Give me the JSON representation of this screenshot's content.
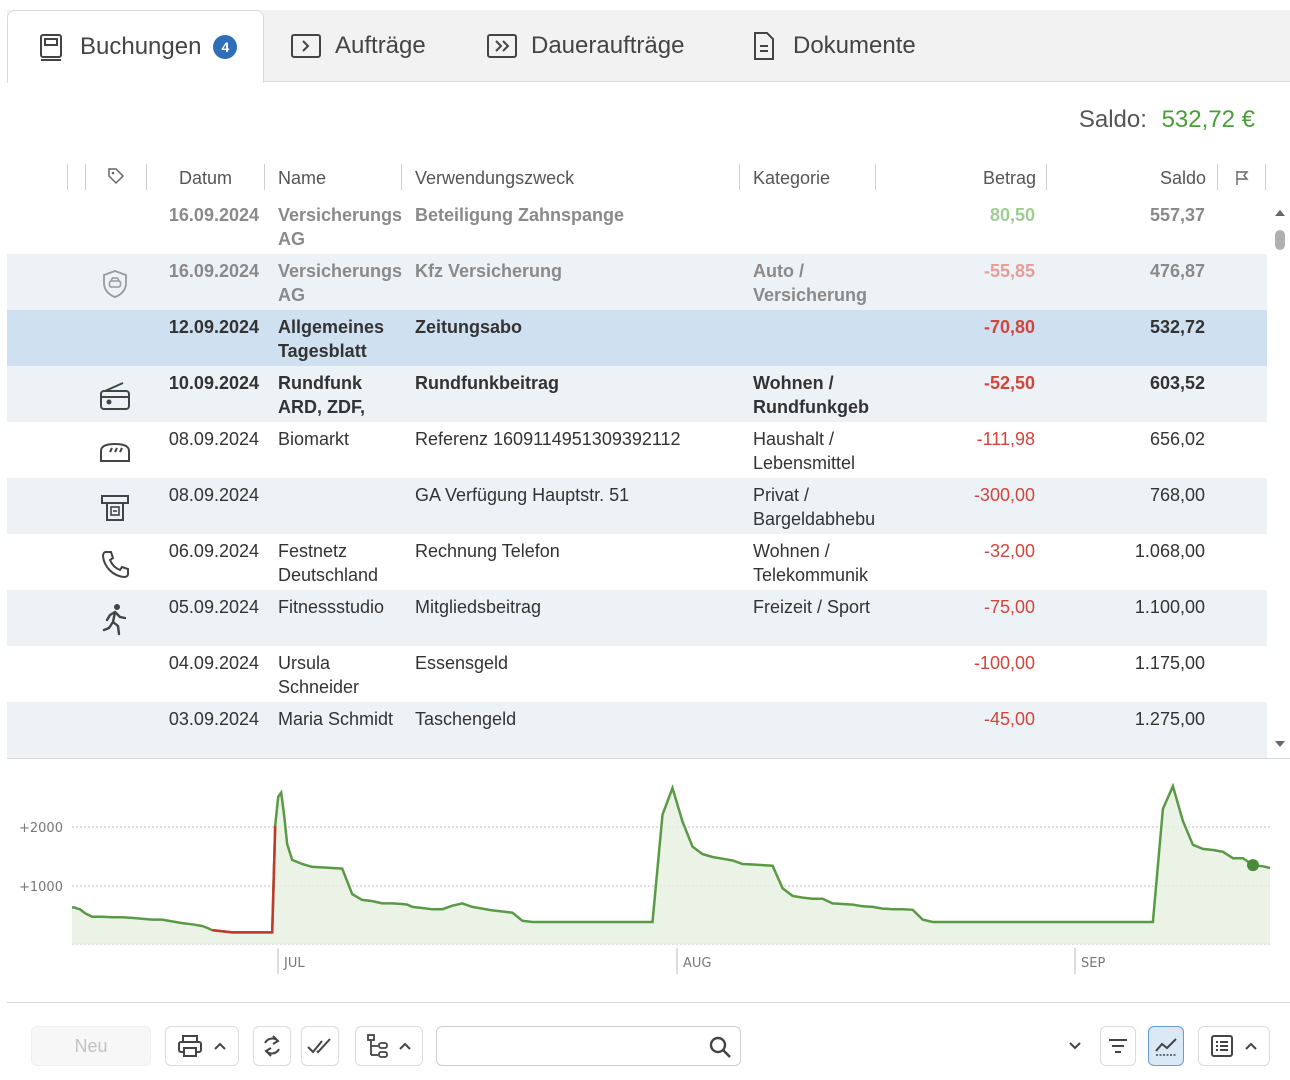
{
  "tabs": [
    {
      "label": "Buchungen",
      "badge": "4",
      "icon": "book-icon",
      "active": true
    },
    {
      "label": "Aufträge",
      "icon": "arrow-box-icon",
      "active": false
    },
    {
      "label": "Daueraufträge",
      "icon": "double-arrow-box-icon",
      "active": false
    },
    {
      "label": "Dokumente",
      "icon": "document-icon",
      "active": false
    }
  ],
  "saldo": {
    "label": "Saldo:",
    "value": "532,72 €"
  },
  "columns": {
    "date": "Datum",
    "name": "Name",
    "purpose": "Verwendungszweck",
    "category": "Kategorie",
    "amount": "Betrag",
    "balance": "Saldo"
  },
  "rows": [
    {
      "date": "16.09.2024",
      "name": "Versicherungs AG",
      "purpose": "Beteiligung Zahnspange",
      "category": "",
      "amount": "80,50",
      "balance": "557,37",
      "icon": "",
      "style": "faded",
      "sign": "pos"
    },
    {
      "date": "16.09.2024",
      "name": "Versicherungs AG",
      "purpose": "Kfz Versicherung",
      "category": "Auto / Versicherung",
      "amount": "-55,85",
      "balance": "476,87",
      "icon": "shield-car-icon",
      "style": "faded",
      "sign": "neg"
    },
    {
      "date": "12.09.2024",
      "name": "Allgemeines Tagesblatt",
      "purpose": "Zeitungsabo",
      "category": "",
      "amount": "-70,80",
      "balance": "532,72",
      "icon": "",
      "style": "bold",
      "sign": "neg"
    },
    {
      "date": "10.09.2024",
      "name": "Rundfunk ARD, ZDF,",
      "purpose": "Rundfunkbeitrag",
      "category": "Wohnen / Rundfunkgeb",
      "amount": "-52,50",
      "balance": "603,52",
      "icon": "radio-icon",
      "style": "bold",
      "sign": "neg"
    },
    {
      "date": "08.09.2024",
      "name": "Biomarkt",
      "purpose": "Referenz 1609114951309392112",
      "category": "Haushalt / Lebensmittel",
      "amount": "-111,98",
      "balance": "656,02",
      "icon": "bread-icon",
      "style": "normal",
      "sign": "neg"
    },
    {
      "date": "08.09.2024",
      "name": "",
      "purpose": "GA Verfügung Hauptstr. 51",
      "category": "Privat / Bargeldabhebu",
      "amount": "-300,00",
      "balance": "768,00",
      "icon": "atm-icon",
      "style": "normal",
      "sign": "neg"
    },
    {
      "date": "06.09.2024",
      "name": "Festnetz Deutschland",
      "purpose": "Rechnung Telefon",
      "category": "Wohnen / Telekommunik",
      "amount": "-32,00",
      "balance": "1.068,00",
      "icon": "phone-icon",
      "style": "normal",
      "sign": "neg"
    },
    {
      "date": "05.09.2024",
      "name": "Fitnessstudio",
      "purpose": "Mitgliedsbeitrag",
      "category": "Freizeit / Sport",
      "amount": "-75,00",
      "balance": "1.100,00",
      "icon": "running-icon",
      "style": "normal",
      "sign": "neg"
    },
    {
      "date": "04.09.2024",
      "name": "Ursula Schneider",
      "purpose": "Essensgeld",
      "category": "",
      "amount": "-100,00",
      "balance": "1.175,00",
      "icon": "",
      "style": "normal",
      "sign": "neg"
    },
    {
      "date": "03.09.2024",
      "name": "Maria Schmidt",
      "purpose": "Taschengeld",
      "category": "",
      "amount": "-45,00",
      "balance": "1.275,00",
      "icon": "",
      "style": "normal",
      "sign": "neg"
    }
  ],
  "chart_data": {
    "type": "area",
    "ytick_labels": [
      "+2000",
      "+1000"
    ],
    "ytick_values": [
      2000,
      1000
    ],
    "month_labels": [
      "JUL",
      "AUG",
      "SEP"
    ],
    "ylim": [
      0,
      2700
    ],
    "colors": {
      "line": "#5a9a47",
      "negative": "#c0392b",
      "fill": "#e6f1e1"
    },
    "x": [
      0,
      3,
      5,
      8,
      10,
      14,
      18,
      20,
      25,
      30,
      40,
      50,
      60,
      80,
      90,
      100,
      110,
      120,
      130,
      135,
      140,
      150,
      160,
      170,
      180,
      190,
      200,
      203,
      206,
      209,
      212,
      215,
      220,
      230,
      240,
      250,
      260,
      270,
      280,
      290,
      300,
      310,
      320,
      330,
      335,
      340,
      350,
      360,
      370,
      380,
      390,
      400,
      410,
      420,
      430,
      440,
      450,
      460,
      470,
      480,
      490,
      500,
      510,
      520,
      530,
      540,
      550,
      560,
      570,
      580,
      590,
      600,
      610,
      620,
      630,
      640,
      650,
      660,
      670,
      680,
      690,
      700,
      710,
      720,
      730,
      740,
      750,
      760,
      770,
      780,
      790,
      800,
      810,
      820,
      830,
      840,
      850,
      860,
      870,
      880,
      890,
      900,
      910,
      920,
      930,
      940,
      950,
      960,
      970,
      980,
      990,
      1000,
      1010,
      1020,
      1030,
      1040,
      1050,
      1060,
      1070,
      1080,
      1090,
      1100,
      1110,
      1120,
      1130,
      1140,
      1150,
      1160,
      1170,
      1180,
      1190,
      1197
    ],
    "y": [
      630,
      630,
      610,
      600,
      570,
      520,
      490,
      470,
      470,
      470,
      460,
      460,
      450,
      420,
      420,
      390,
      360,
      340,
      310,
      280,
      240,
      220,
      200,
      200,
      200,
      200,
      200,
      2040,
      2540,
      2610,
      2210,
      1720,
      1450,
      1380,
      1330,
      1320,
      1310,
      1300,
      860,
      760,
      740,
      700,
      700,
      690,
      680,
      640,
      620,
      600,
      600,
      660,
      700,
      640,
      610,
      580,
      560,
      540,
      400,
      380,
      380,
      380,
      380,
      380,
      380,
      380,
      380,
      380,
      380,
      380,
      380,
      380,
      2230,
      2690,
      2110,
      1680,
      1550,
      1500,
      1470,
      1440,
      1380,
      1370,
      1360,
      1350,
      960,
      830,
      800,
      780,
      780,
      700,
      690,
      680,
      650,
      640,
      610,
      600,
      600,
      590,
      420,
      380,
      380,
      380,
      380,
      380,
      380,
      380,
      380,
      380,
      380,
      380,
      380,
      380,
      380,
      380,
      380,
      380,
      380,
      380,
      380,
      380,
      380,
      380,
      2330,
      2720,
      2120,
      1710,
      1640,
      1620,
      1590,
      1480,
      1480,
      1360,
      1340,
      1310,
      980,
      890,
      830,
      800,
      760,
      760,
      690,
      620
    ]
  },
  "toolbar": {
    "new_label": "Neu",
    "search_placeholder": ""
  }
}
